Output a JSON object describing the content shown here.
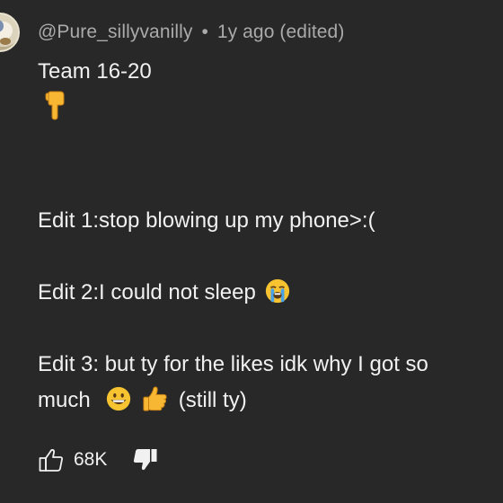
{
  "comment": {
    "author": "@Pure_sillyvanilly",
    "separator": "•",
    "age": "1y ago (edited)",
    "lines": {
      "l1": "Team 16-20",
      "l3": "Edit 1:stop blowing up my phone>:(",
      "l4": "Edit 2:I could not sleep",
      "l5": "Edit 3: but ty for the likes idk why I got so",
      "l6a": "much",
      "l6b": "(still ty)"
    },
    "emojis": {
      "pointing_down": "pointing-down-emoji",
      "crying": "loudly-crying-emoji",
      "grin": "grinning-face-emoji",
      "thumbs_up": "thumbs-up-emoji"
    }
  },
  "actions": {
    "like_count": "68K",
    "like_icon": "thumbs-up-outline-icon",
    "dislike_icon": "thumbs-down-filled-icon"
  },
  "colors": {
    "background": "#282828",
    "text": "#f1f1f1",
    "meta": "#aaaaaa",
    "emoji_yellow": "#f7c331"
  }
}
